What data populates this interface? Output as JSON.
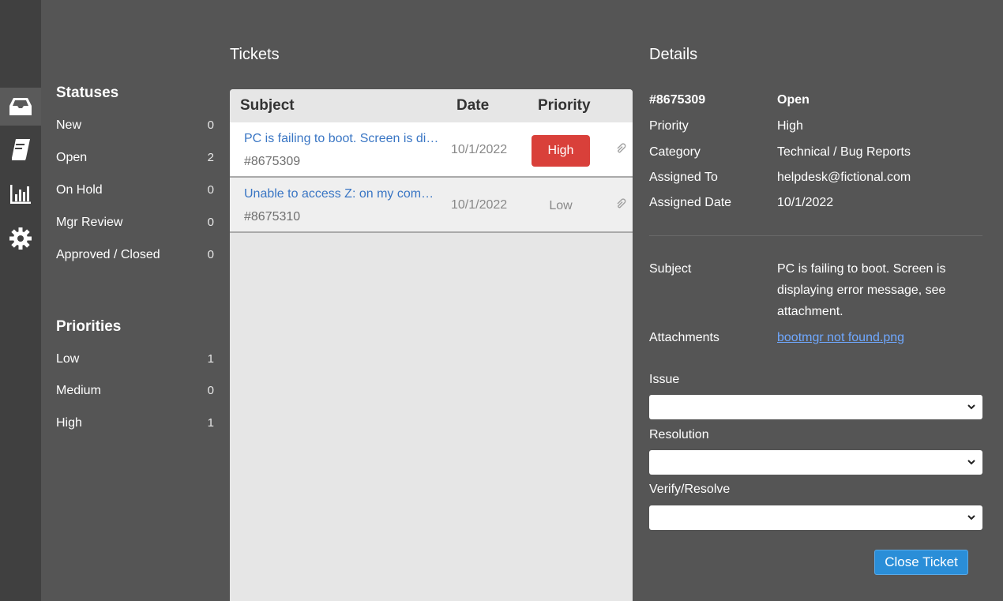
{
  "nav": {
    "items": [
      {
        "name": "inbox-icon",
        "active": true
      },
      {
        "name": "book-icon",
        "active": false
      },
      {
        "name": "bar-chart-icon",
        "active": false
      },
      {
        "name": "gear-icon",
        "active": false
      }
    ]
  },
  "filters": {
    "statuses_title": "Statuses",
    "statuses": [
      {
        "label": "New",
        "count": "0"
      },
      {
        "label": "Open",
        "count": "2"
      },
      {
        "label": "On Hold",
        "count": "0"
      },
      {
        "label": "Mgr Review",
        "count": "0"
      },
      {
        "label": "Approved / Closed",
        "count": "0"
      }
    ],
    "priorities_title": "Priorities",
    "priorities": [
      {
        "label": "Low",
        "count": "1"
      },
      {
        "label": "Medium",
        "count": "0"
      },
      {
        "label": "High",
        "count": "1"
      }
    ]
  },
  "tickets": {
    "title": "Tickets",
    "columns": {
      "subject": "Subject",
      "date": "Date",
      "priority": "Priority"
    },
    "rows": [
      {
        "subject": "PC is failing to boot. Screen is displaying error message, see attachment.",
        "number": "#8675309",
        "date": "10/1/2022",
        "priority": "High",
        "attachment_icon": "paperclip-icon"
      },
      {
        "subject": "Unable to access Z: on my computer",
        "number": "#8675310",
        "date": "10/1/2022",
        "priority": "Low",
        "attachment_icon": "paperclip-icon"
      }
    ]
  },
  "details": {
    "title": "Details",
    "ticket_number": "#8675309",
    "status": "Open",
    "priority_label": "Priority",
    "priority_value": "High",
    "category_label": "Category",
    "category_value": "Technical / Bug Reports",
    "assigned_to_label": "Assigned To",
    "assigned_to_value": "helpdesk@fictional.com",
    "assigned_date_label": "Assigned Date",
    "assigned_date_value": "10/1/2022",
    "subject_label": "Subject",
    "subject_value": "PC is failing to boot. Screen is displaying error message, see attachment.",
    "attachments_label": "Attachments",
    "attachment_name": "bootmgr not found.png",
    "issue_label": "Issue",
    "issue_value": "",
    "resolution_label": "Resolution",
    "resolution_value": "",
    "verify_label": "Verify/Resolve",
    "verify_value": "",
    "close_button": "Close Ticket"
  },
  "colors": {
    "background": "#555555",
    "iconbar": "#404040",
    "link": "#3a76c4",
    "high_priority": "#d9403a",
    "primary_button": "#2a8ed8"
  }
}
